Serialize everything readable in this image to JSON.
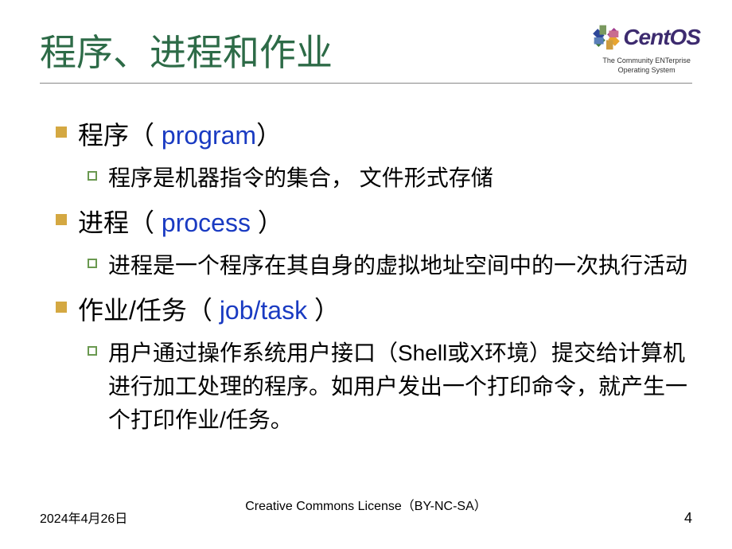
{
  "title": "程序、进程和作业",
  "logo": {
    "text": "CentOS",
    "tagline1": "The Community ENTerprise",
    "tagline2": "Operating System"
  },
  "items": [
    {
      "label_cn": "程序",
      "paren_open": "（",
      "label_en": " program",
      "paren_close": "）",
      "sub": "程序是机器指令的集合，  文件形式存储"
    },
    {
      "label_cn": "进程",
      "paren_open": "（",
      "label_en": " process ",
      "paren_close": "）",
      "sub": "进程是一个程序在其自身的虚拟地址空间中的一次执行活动"
    },
    {
      "label_cn": "作业/任务",
      "paren_open": "（",
      "label_en": " job/task ",
      "paren_close": "）",
      "sub": "用户通过操作系统用户接口（Shell或X环境）提交给计算机进行加工处理的程序。如用户发出一个打印命令，就产生一个打印作业/任务。"
    }
  ],
  "footer": {
    "date": "2024年4月26日",
    "license": "Creative Commons License（BY-NC-SA）",
    "pagenum": "4"
  }
}
